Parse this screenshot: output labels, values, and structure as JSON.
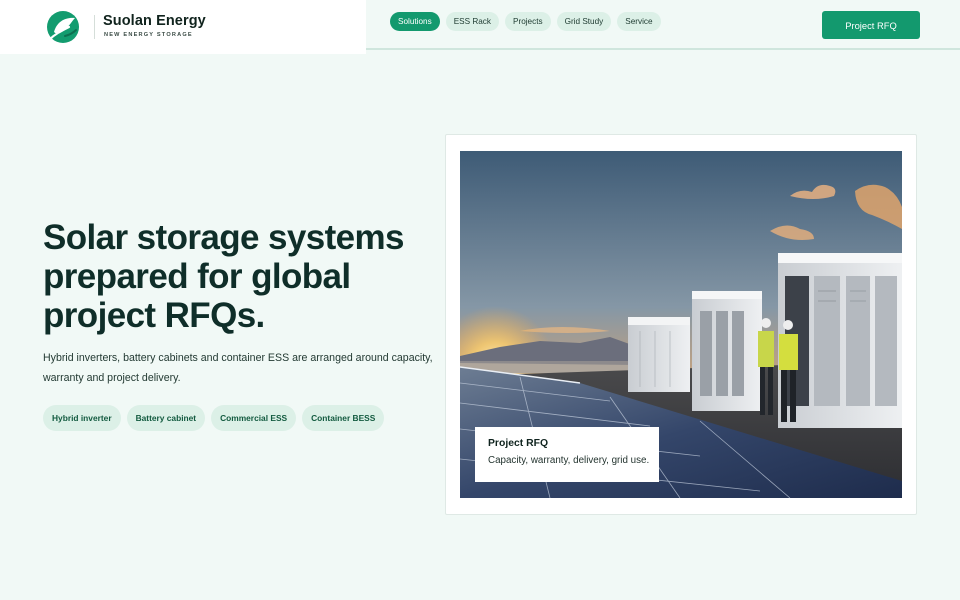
{
  "brand": {
    "name": "Suolan Energy",
    "tagline": "NEW ENERGY STORAGE",
    "logo_icon": "leaf-logo-icon"
  },
  "nav": {
    "tabs": [
      {
        "label": "Solutions",
        "active": true
      },
      {
        "label": "ESS Rack",
        "active": false
      },
      {
        "label": "Projects",
        "active": false
      },
      {
        "label": "Grid Study",
        "active": false
      },
      {
        "label": "Service",
        "active": false
      }
    ],
    "cta_label": "Project RFQ"
  },
  "hero": {
    "title_lines": [
      "Solar storage systems",
      "prepared for global",
      "project RFQs."
    ],
    "description": "Hybrid inverters, battery cabinets and container ESS are arranged around capacity, warranty and project delivery.",
    "chips": [
      "Hybrid inverter",
      "Battery cabinet",
      "Commercial ESS",
      "Container BESS"
    ]
  },
  "media": {
    "caption_title": "Project RFQ",
    "caption_text": "Capacity, warranty, delivery, grid use."
  },
  "colors": {
    "accent": "#13996e",
    "chip_bg": "#dcf0e7",
    "page_bg": "#f1f9f6",
    "heading": "#0f2e29"
  }
}
